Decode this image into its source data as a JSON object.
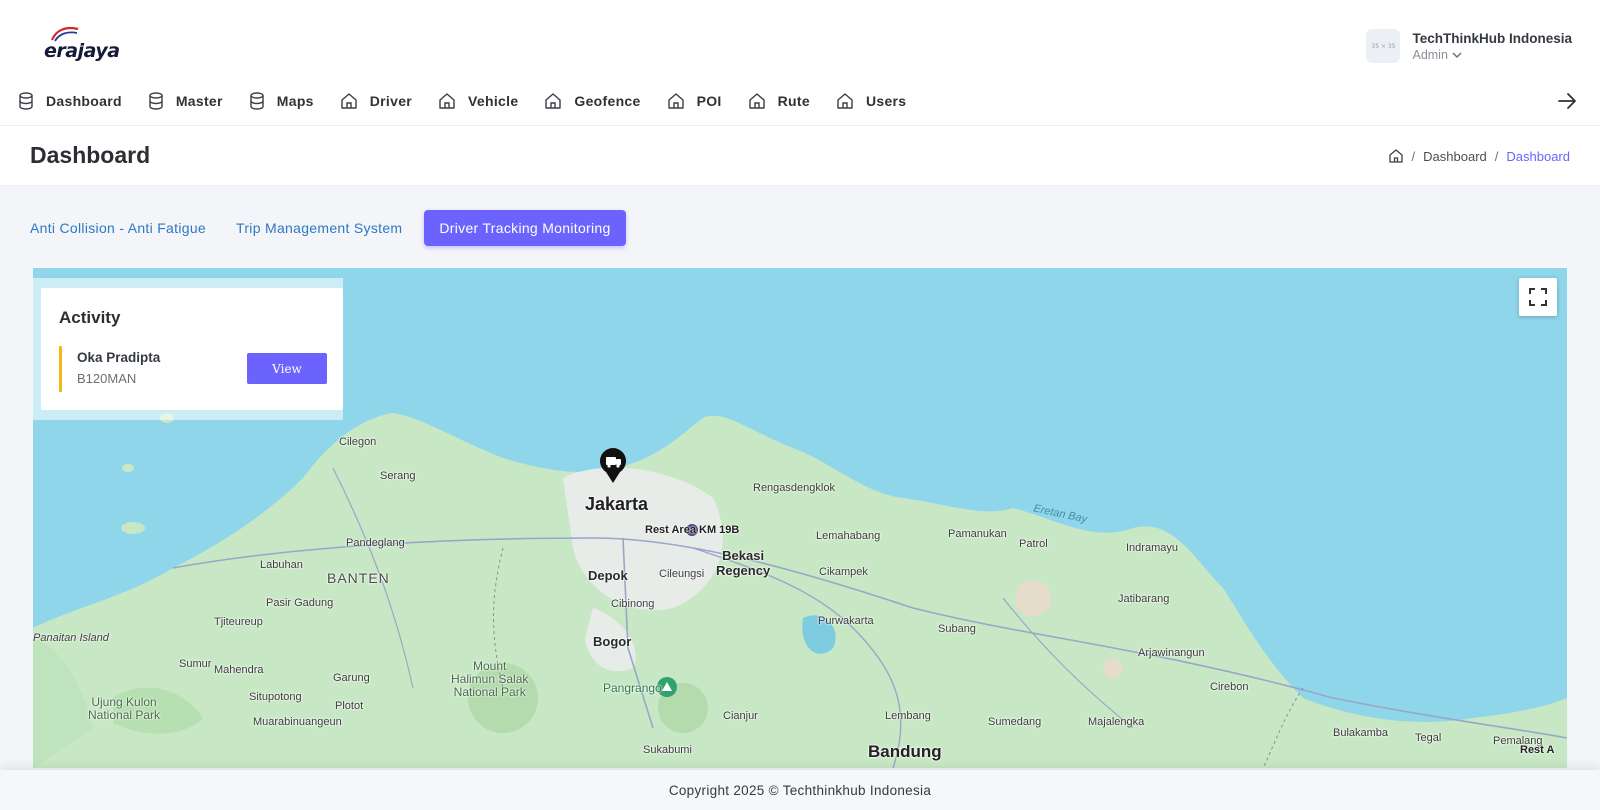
{
  "header": {
    "logo_text": "erajaya",
    "company": "TechThinkHub Indonesia",
    "role": "Admin",
    "avatar_text": "35 × 35"
  },
  "nav": {
    "items": [
      {
        "label": "Dashboard",
        "icon": "database-icon"
      },
      {
        "label": "Master",
        "icon": "database-icon"
      },
      {
        "label": "Maps",
        "icon": "database-icon"
      },
      {
        "label": "Driver",
        "icon": "home-icon"
      },
      {
        "label": "Vehicle",
        "icon": "home-icon"
      },
      {
        "label": "Geofence",
        "icon": "home-icon"
      },
      {
        "label": "POI",
        "icon": "home-icon"
      },
      {
        "label": "Rute",
        "icon": "home-icon"
      },
      {
        "label": "Users",
        "icon": "home-icon"
      }
    ],
    "logout_icon": "arrow-right-icon"
  },
  "page": {
    "title": "Dashboard",
    "breadcrumb": [
      "Dashboard",
      "Dashboard"
    ]
  },
  "tabs": [
    {
      "label": "Anti Collision - Anti Fatigue",
      "active": false
    },
    {
      "label": "Trip Management System",
      "active": false
    },
    {
      "label": "Driver Tracking Monitoring",
      "active": true
    }
  ],
  "activity": {
    "title": "Activity",
    "items": [
      {
        "driver": "Oka Pradipta",
        "plate": "B120MAN",
        "button": "View"
      }
    ]
  },
  "map": {
    "labels": {
      "jakarta": "Jakarta",
      "banten": "BANTEN",
      "bekasi": "Bekasi\nRegency",
      "depok": "Depok",
      "bogor": "Bogor",
      "bandung": "Bandung",
      "rest_area": "Rest Area KM 19B",
      "cilegon": "Cilegon",
      "serang": "Serang",
      "pandeglang": "Pandeglang",
      "labuhan": "Labuhan",
      "pasir_gadung": "Pasir Gadung",
      "tjiteureup": "Tjiteureup",
      "panaitan": "Panaitan Island",
      "sumur": "Sumur",
      "mahendra": "Mahendra",
      "ujung_kulon": "Ujung Kulon\nNational Park",
      "situpotong": "Situpotong",
      "muarabinuangeun": "Muarabinuangeun",
      "garung": "Garung",
      "plotot": "Plotot",
      "halimun": "Mount\nHalimun Salak\nNational Park",
      "pangrango": "Pangrango",
      "cianjur": "Cianjur",
      "sukabumi": "Sukabumi",
      "cileungsi": "Cileungsi",
      "cibinong": "Cibinong",
      "rengasdengklok": "Rengasdengklok",
      "lemahabang": "Lemahabang",
      "cikampek": "Cikampek",
      "purwakarta": "Purwakarta",
      "subang": "Subang",
      "lembang": "Lembang",
      "sumedang": "Sumedang",
      "majalengka": "Majalengka",
      "pamanukan": "Pamanukan",
      "patrol": "Patrol",
      "indramayu": "Indramayu",
      "jatibarang": "Jatibarang",
      "arjawinangun": "Arjawinangun",
      "cirebon": "Cirebon",
      "bulakamba": "Bulakamba",
      "tegal": "Tegal",
      "pemalang": "Pemalang",
      "eretan_bay": "Eretan Bay",
      "rest_area_2": "Rest A"
    }
  },
  "footer": {
    "copyright": "Copyright 2025 © Techthinkhub Indonesia"
  },
  "colors": {
    "accent": "#6c63ff",
    "link": "#2f78c4",
    "sea": "#8fd6ea",
    "land": "#c8e8c5",
    "activity_marker": "#f5b71a"
  }
}
